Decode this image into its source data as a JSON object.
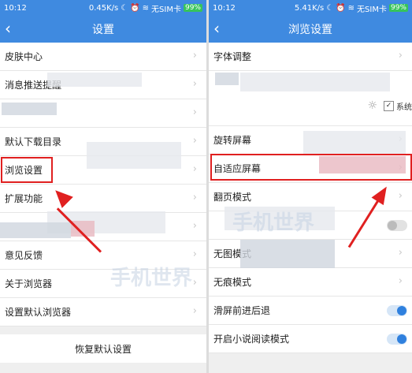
{
  "left": {
    "status": {
      "time": "10:12",
      "speed": "0.45K/s",
      "sim": "无SIM卡",
      "battery": "99%"
    },
    "title": "设置",
    "items": [
      {
        "label": "皮肤中心"
      },
      {
        "label": "消息推送提醒"
      },
      {
        "label": ""
      },
      {
        "label": "默认下载目录"
      },
      {
        "label": "浏览设置"
      },
      {
        "label": "扩展功能"
      },
      {
        "label": ""
      },
      {
        "label": "意见反馈"
      },
      {
        "label": "关于浏览器"
      },
      {
        "label": "设置默认浏览器"
      }
    ],
    "reset_label": "恢复默认设置"
  },
  "right": {
    "status": {
      "time": "10:12",
      "speed": "5.41K/s",
      "sim": "无SIM卡",
      "battery": "99%"
    },
    "title": "浏览设置",
    "items": [
      {
        "label": "字体调整"
      },
      {
        "label": ""
      },
      {
        "label": "旋转屏幕"
      },
      {
        "label": "自适应屏幕"
      },
      {
        "label": "翻页模式"
      },
      {
        "label": ""
      },
      {
        "label": "无图模式"
      },
      {
        "label": "无痕模式"
      },
      {
        "label": "滑屏前进后退",
        "toggle": "on"
      },
      {
        "label": "开启小说阅读模式",
        "toggle": "on"
      }
    ],
    "brightness_label": "系统"
  },
  "colors": {
    "accent": "#3f8ae0",
    "highlight": "#e02020"
  }
}
